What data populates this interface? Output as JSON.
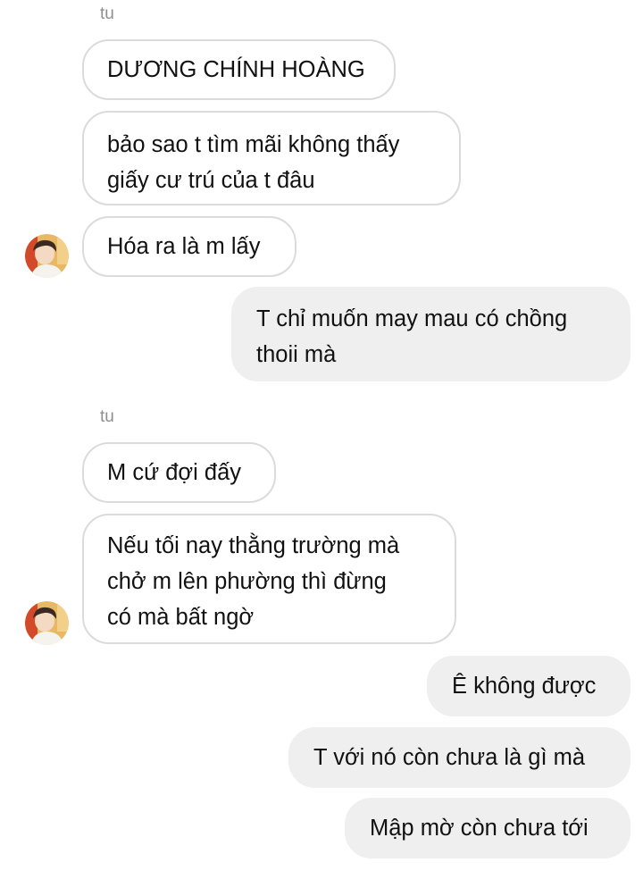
{
  "thread": {
    "group1": {
      "sender": "tu",
      "messages": [
        {
          "lines": [
            "DƯƠNG CHÍNH HOÀNG"
          ]
        },
        {
          "lines": [
            "bảo sao t tìm mãi không thấy",
            "giấy cư trú của t đâu"
          ]
        },
        {
          "lines": [
            "Hóa ra là m lấy"
          ]
        }
      ]
    },
    "reply1": {
      "lines": [
        "T chỉ muốn may mau có chồng",
        "thoii mà"
      ]
    },
    "group2": {
      "sender": "tu",
      "messages": [
        {
          "lines": [
            "M cứ đợi đấy"
          ]
        },
        {
          "lines": [
            "Nếu tối nay thằng trường mà",
            "chở m lên phường thì đừng",
            "có mà bất ngờ"
          ]
        }
      ]
    },
    "replies2": [
      {
        "lines": [
          "Ê không được"
        ]
      },
      {
        "lines": [
          "T với nó còn chưa là gì mà"
        ]
      },
      {
        "lines": [
          "Mập mờ còn chưa tới"
        ]
      }
    ]
  },
  "colors": {
    "received_bubble_border": "#dbdbdb",
    "sent_bubble_bg": "#efefef",
    "sender_name": "#8e8e8e"
  },
  "icons": {
    "avatar": "contact-avatar-photo"
  }
}
